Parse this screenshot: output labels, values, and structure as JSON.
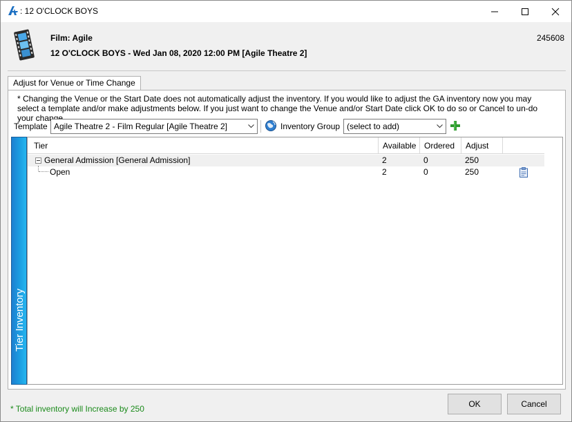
{
  "window": {
    "title": ": 12 O'CLOCK BOYS",
    "controls": {
      "minimize": "–",
      "maximize": "☐",
      "close": "✕"
    }
  },
  "header": {
    "film_label": "Film: Agile",
    "show_label": "12 O'CLOCK BOYS - Wed Jan 08, 2020 12:00 PM [Agile Theatre 2]",
    "event_id": "245608",
    "icon": "film-strip-icon"
  },
  "tab": {
    "label": "Adjust for Venue or Time Change"
  },
  "info_text": "* Changing the Venue or the Start Date does not automatically adjust the inventory. If you would like to adjust the GA inventory now you may select a template and/or make adjustments below. If you just want to change the Venue and/or Start Date click OK to do so or Cancel to un-do your change.",
  "toolbar": {
    "template_label": "Template",
    "template_value": "Agile Theatre 2 - Film Regular [Agile Theatre 2]",
    "inventory_group_label": "Inventory Group",
    "inventory_group_value": "(select to add)",
    "icons": [
      "globe-icon",
      "add-plus-icon"
    ]
  },
  "side_tab": {
    "label": "Tier Inventory"
  },
  "grid": {
    "columns": [
      "Tier",
      "Available",
      "Ordered",
      "Adjust"
    ],
    "rows": [
      {
        "tier": "General Admission [General Admission]",
        "available": "2",
        "ordered": "0",
        "adjust": "250",
        "level": 0
      },
      {
        "tier": "Open",
        "available": "2",
        "ordered": "0",
        "adjust": "250",
        "level": 1
      }
    ]
  },
  "footer": {
    "status": "* Total inventory will Increase by 250",
    "ok_label": "OK",
    "cancel_label": "Cancel"
  },
  "colors": {
    "accent": "#1b9be0",
    "status_green": "#1a8a1a"
  }
}
